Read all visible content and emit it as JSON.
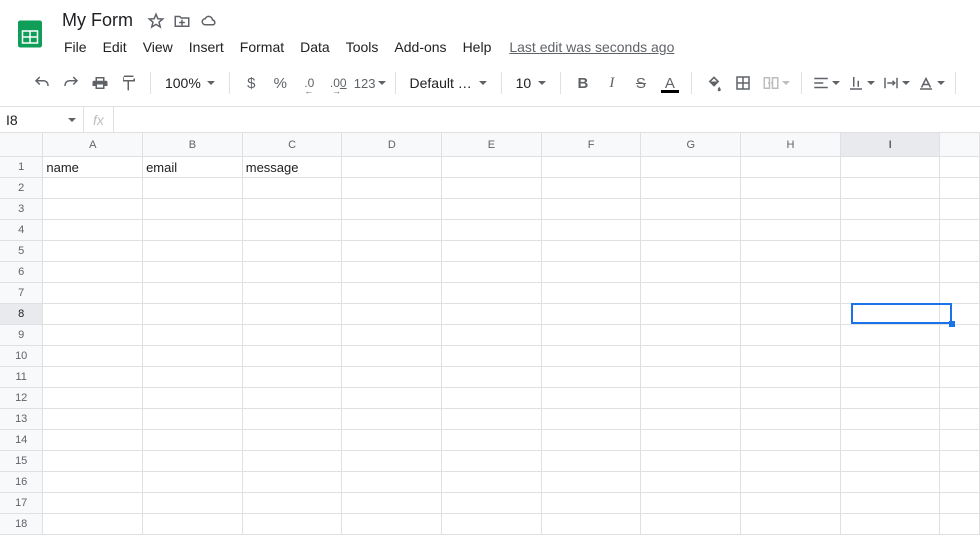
{
  "doc": {
    "title": "My Form"
  },
  "menus": [
    "File",
    "Edit",
    "View",
    "Insert",
    "Format",
    "Data",
    "Tools",
    "Add-ons",
    "Help"
  ],
  "last_edit": "Last edit was seconds ago",
  "toolbar": {
    "zoom": "100%",
    "font": "Default (Ari...",
    "size": "10",
    "more_decimal": ".0",
    "less_decimal": ".00",
    "format123": "123"
  },
  "name_box": "I8",
  "formula": "",
  "columns": [
    "A",
    "B",
    "C",
    "D",
    "E",
    "F",
    "G",
    "H",
    "I"
  ],
  "rows": [
    "1",
    "2",
    "3",
    "4",
    "5",
    "6",
    "7",
    "8",
    "9",
    "10",
    "11",
    "12",
    "13",
    "14",
    "15",
    "16",
    "17",
    "18"
  ],
  "cells": {
    "A1": "name",
    "B1": "email",
    "C1": "message"
  },
  "selected": {
    "col": "I",
    "row": "8"
  }
}
